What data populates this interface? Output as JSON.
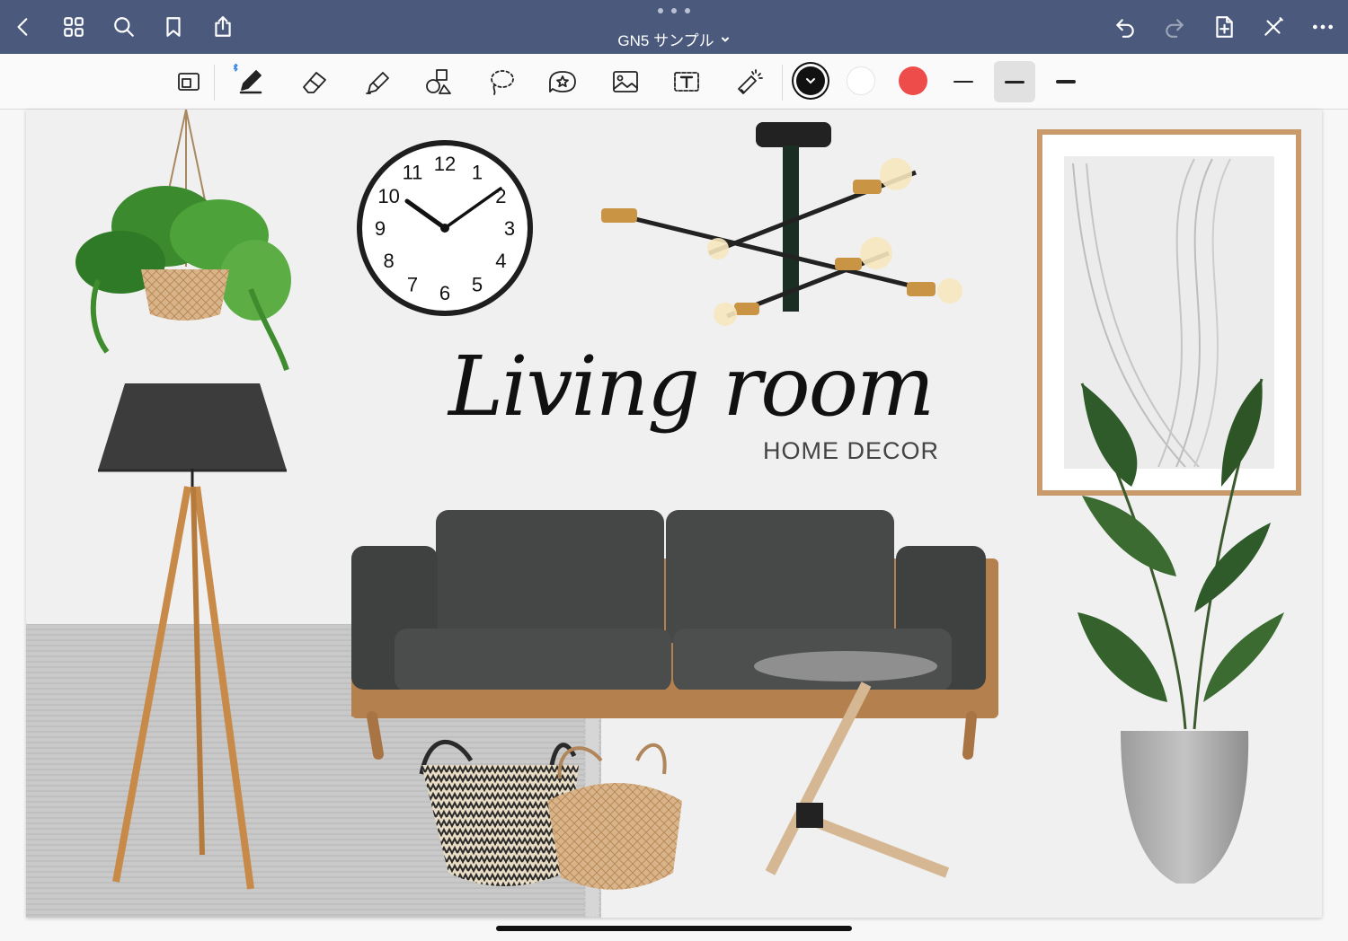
{
  "topbar": {
    "title": "GN5 サンプル",
    "left_icons": [
      "back-icon",
      "grid-icon",
      "search-icon",
      "bookmark-icon",
      "share-icon"
    ],
    "right_icons": [
      "undo-icon",
      "redo-icon",
      "add-page-icon",
      "collapse-toolbar-icon",
      "more-icon"
    ]
  },
  "toolbar": {
    "tools": [
      "zoom-window-icon",
      "pen-icon",
      "eraser-icon",
      "highlighter-icon",
      "shapes-icon",
      "lasso-icon",
      "sticker-icon",
      "image-icon",
      "text-icon",
      "laser-pointer-icon"
    ],
    "selected_tool": "pen-icon",
    "colors": [
      "#111111",
      "#ffffff",
      "#ee4b4b"
    ],
    "selected_color": "#111111",
    "thickness_selected_index": 1
  },
  "canvas": {
    "heading_script": "Living room",
    "heading_sub": "HOME DECOR",
    "clock_numbers": [
      "12",
      "1",
      "2",
      "3",
      "4",
      "5",
      "6",
      "7",
      "8",
      "9",
      "10",
      "11"
    ]
  }
}
